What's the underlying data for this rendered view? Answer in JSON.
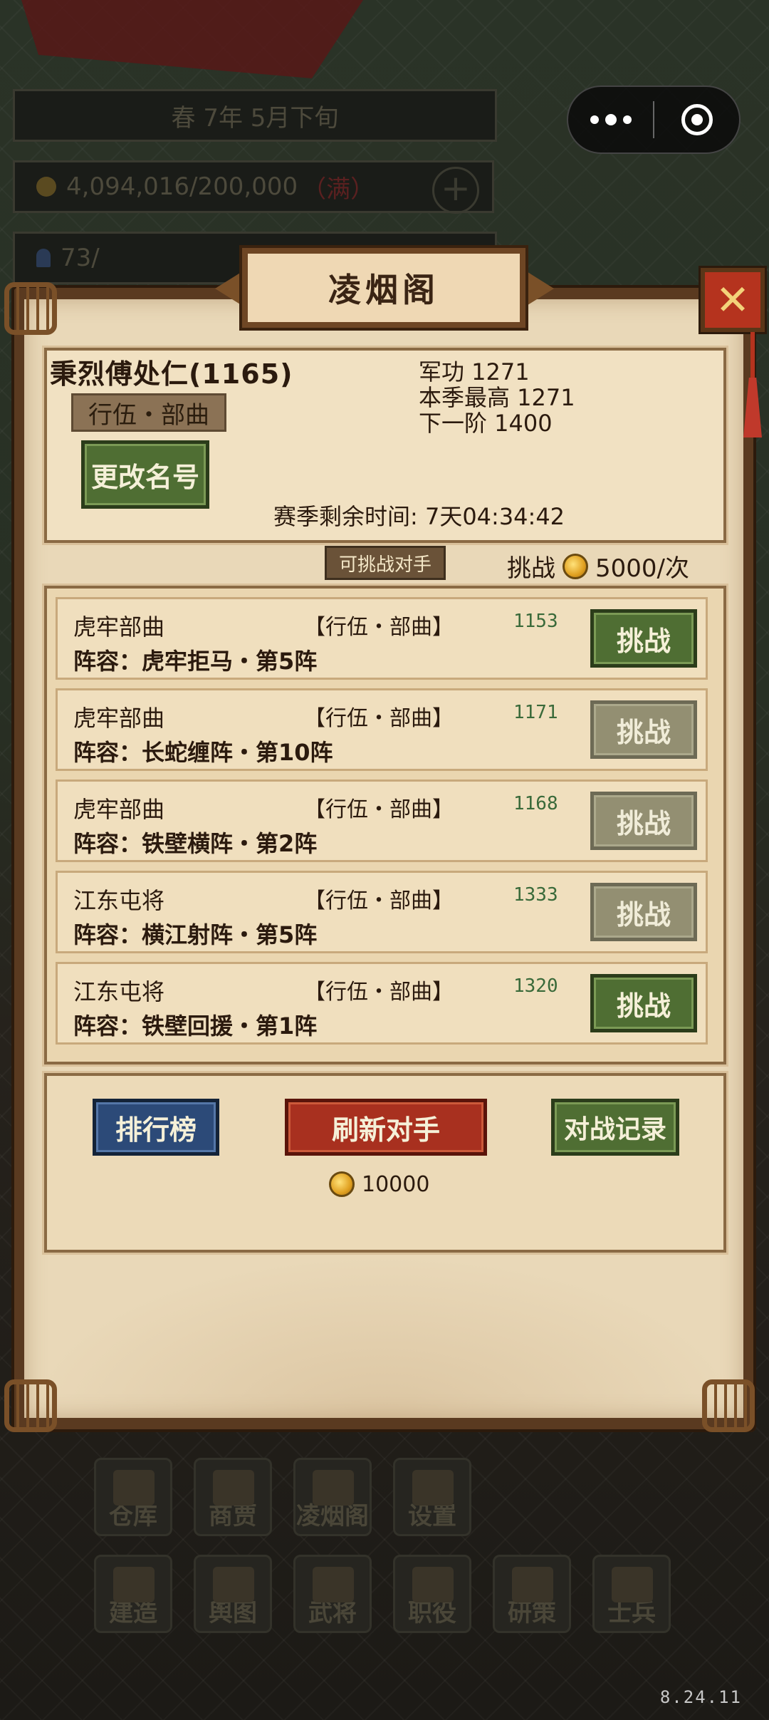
{
  "background": {
    "date": "春  7年  5月下旬",
    "gold": "4,094,016/200,000",
    "gold_full": "（满）",
    "population": "73/"
  },
  "panel": {
    "title": "凌烟阁",
    "close_icon": "close-x-icon",
    "player": {
      "name": "秉烈傅处仁(1165)",
      "rank": "行伍・部曲",
      "rename_label": "更改名号"
    },
    "stats": {
      "merit": "军功 1271",
      "season_best": "本季最高 1271",
      "next_tier": "下一阶 1400"
    },
    "season_remaining": "赛季剩余时间: 7天04:34:42",
    "opponents_label": "可挑战对手",
    "challenge_cost_prefix": "挑战",
    "challenge_cost": "5000/次",
    "opponents": [
      {
        "unit": "虎牢部曲",
        "rank": "【行伍・部曲】",
        "score": "1153",
        "lineup": "阵容：虎牢拒马・第5阵",
        "action": "挑战",
        "enabled": true
      },
      {
        "unit": "虎牢部曲",
        "rank": "【行伍・部曲】",
        "score": "1171",
        "lineup": "阵容：长蛇缠阵・第10阵",
        "action": "挑战",
        "enabled": false
      },
      {
        "unit": "虎牢部曲",
        "rank": "【行伍・部曲】",
        "score": "1168",
        "lineup": "阵容：铁壁横阵・第2阵",
        "action": "挑战",
        "enabled": false
      },
      {
        "unit": "江东屯将",
        "rank": "【行伍・部曲】",
        "score": "1333",
        "lineup": "阵容：横江射阵・第5阵",
        "action": "挑战",
        "enabled": false
      },
      {
        "unit": "江东屯将",
        "rank": "【行伍・部曲】",
        "score": "1320",
        "lineup": "阵容：铁壁回援・第1阵",
        "action": "挑战",
        "enabled": true
      }
    ],
    "actions": {
      "leaderboard": "排行榜",
      "refresh": "刷新对手",
      "refresh_cost": "10000",
      "battle_log": "对战记录"
    }
  },
  "dock": {
    "row1": [
      "仓库",
      "商贾",
      "凌烟阁",
      "设置"
    ],
    "row2": [
      "建造",
      "舆图",
      "武将",
      "职役",
      "研策",
      "士兵"
    ]
  },
  "version": "8.24.11"
}
